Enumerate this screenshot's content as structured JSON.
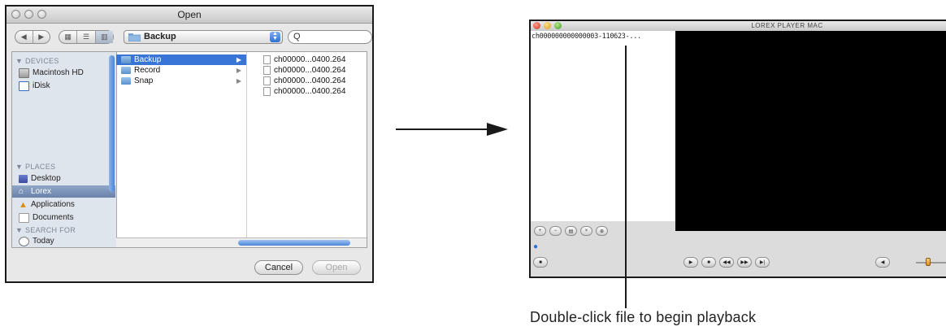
{
  "open_dialog": {
    "title": "Open",
    "location": "Backup",
    "search_glyph": "Q",
    "sidebar": {
      "devices_header": "DEVICES",
      "devices": [
        {
          "label": "Macintosh HD",
          "icon": "hard-drive-icon"
        },
        {
          "label": "iDisk",
          "icon": "idisk-icon"
        }
      ],
      "places_header": "PLACES",
      "places": [
        {
          "label": "Desktop",
          "icon": "desktop-icon"
        },
        {
          "label": "Lorex",
          "icon": "home-icon",
          "selected": true
        },
        {
          "label": "Applications",
          "icon": "applications-icon"
        },
        {
          "label": "Documents",
          "icon": "documents-icon"
        }
      ],
      "search_header": "SEARCH FOR",
      "search_items": [
        {
          "label": "Today",
          "icon": "clock-icon"
        }
      ]
    },
    "column1": [
      {
        "label": "Backup",
        "selected": true
      },
      {
        "label": "Record",
        "selected": false
      },
      {
        "label": "Snap",
        "selected": false
      }
    ],
    "column2": [
      {
        "label": "ch00000...0400.264"
      },
      {
        "label": "ch00000...0400.264"
      },
      {
        "label": "ch00000...0400.264"
      },
      {
        "label": "ch00000...0400.264"
      }
    ],
    "cancel_label": "Cancel",
    "open_label": "Open"
  },
  "player": {
    "title": "LOREX PLAYER MAC",
    "playlist": [
      {
        "label": "ch000000000000003-110623-..."
      }
    ]
  },
  "caption": "Double-click file to begin playback",
  "colors": {
    "selection": "#3875d7",
    "video_bg": "#000000",
    "sidebar_bg": "#dfe5ed"
  }
}
